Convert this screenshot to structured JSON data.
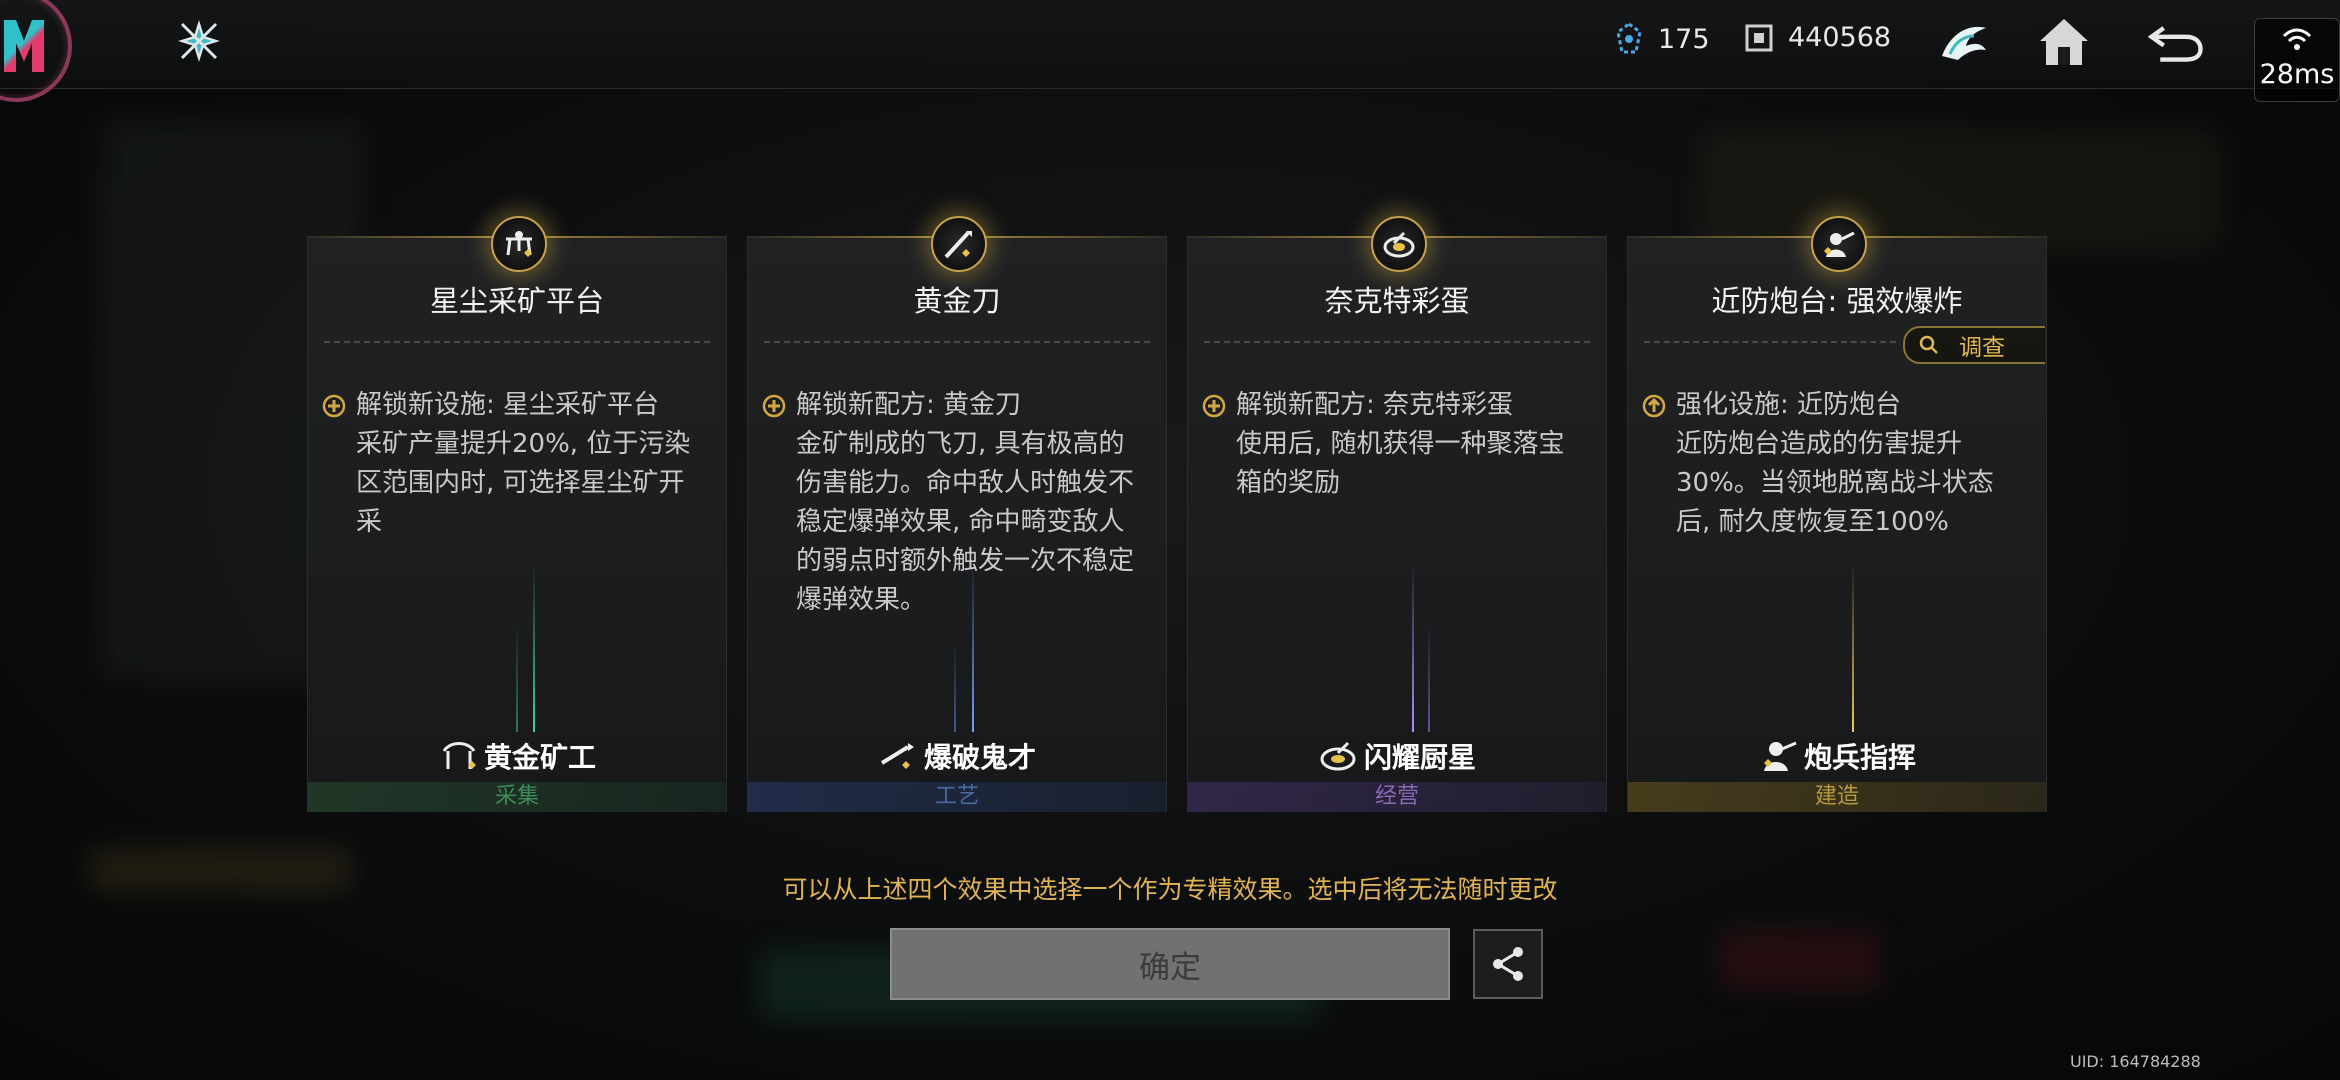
{
  "topbar": {
    "crystal_count": "175",
    "coin_count": "440568",
    "latency": "28ms",
    "icons": [
      "game-logo-icon",
      "faction-emblem-icon",
      "crystal-icon",
      "coin-icon",
      "wing-emblem-icon",
      "home-icon",
      "back-icon",
      "wifi-icon"
    ]
  },
  "cards": [
    {
      "title": "星尘采矿平台",
      "desc": "解锁新设施: 星尘采矿平台\n采矿产量提升20%, 位于污染区范围内时, 可选择星尘矿开采",
      "trait": "黄金矿工",
      "category": "采集",
      "category_color": "#3d8a5a",
      "beam_color": "#3fd6a0"
    },
    {
      "title": "黄金刀",
      "desc": "解锁新配方: 黄金刀\n金矿制成的飞刀, 具有极高的伤害能力。命中敌人时触发不稳定爆弹效果, 命中畸变敌人的弱点时额外触发一次不稳定爆弹效果。",
      "trait": "爆破鬼才",
      "category": "工艺",
      "category_color": "#4a6aa0",
      "beam_color": "#6fa0ff"
    },
    {
      "title": "奈克特彩蛋",
      "desc": "解锁新配方: 奈克特彩蛋\n使用后, 随机获得一种聚落宝箱的奖励",
      "trait": "闪耀厨星",
      "category": "经营",
      "category_color": "#8a6ab4",
      "beam_color": "#b88bff"
    },
    {
      "title": "近防炮台: 强效爆炸",
      "desc": "强化设施: 近防炮台\n近防炮台造成的伤害提升30%。当领地脱离战斗状态后, 耐久度恢复至100%",
      "trait": "炮兵指挥",
      "category": "建造",
      "category_color": "#b89a3a",
      "beam_color": "#f0c850"
    }
  ],
  "investigate_label": "调查",
  "hint": "可以从上述四个效果中选择一个作为专精效果。选中后将无法随时更改",
  "confirm_label": "确定",
  "uid": "UID: 164784288"
}
